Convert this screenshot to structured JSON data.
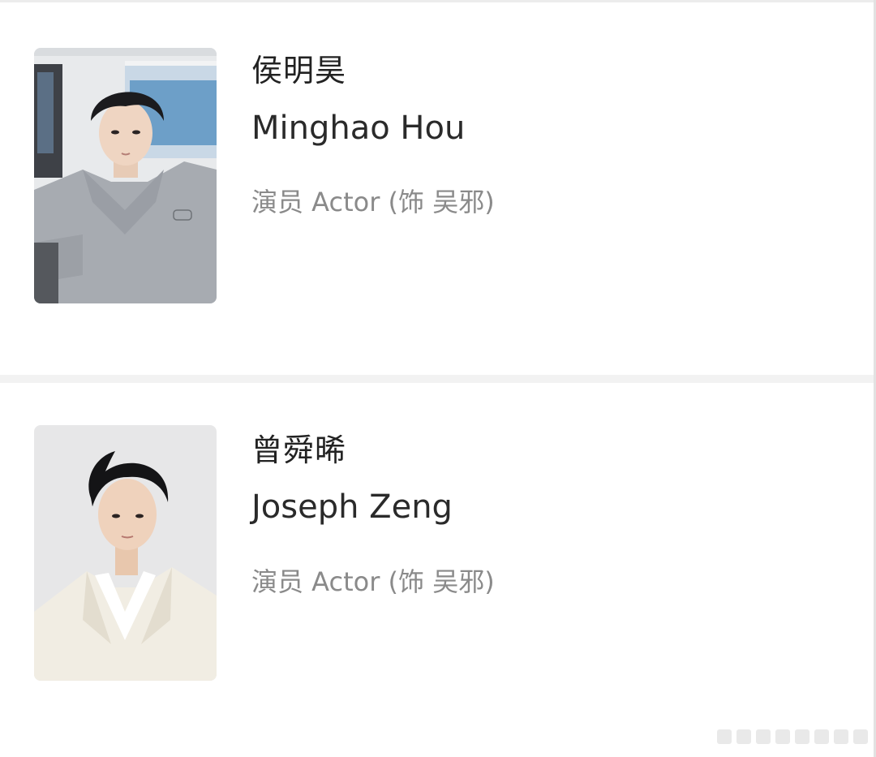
{
  "cast": [
    {
      "name_cn": "侯明昊",
      "name_en": "Minghao Hou",
      "role": "演员 Actor (饰 吴邪)"
    },
    {
      "name_cn": "曾舜晞",
      "name_en": "Joseph Zeng",
      "role": "演员 Actor (饰 吴邪)"
    }
  ]
}
